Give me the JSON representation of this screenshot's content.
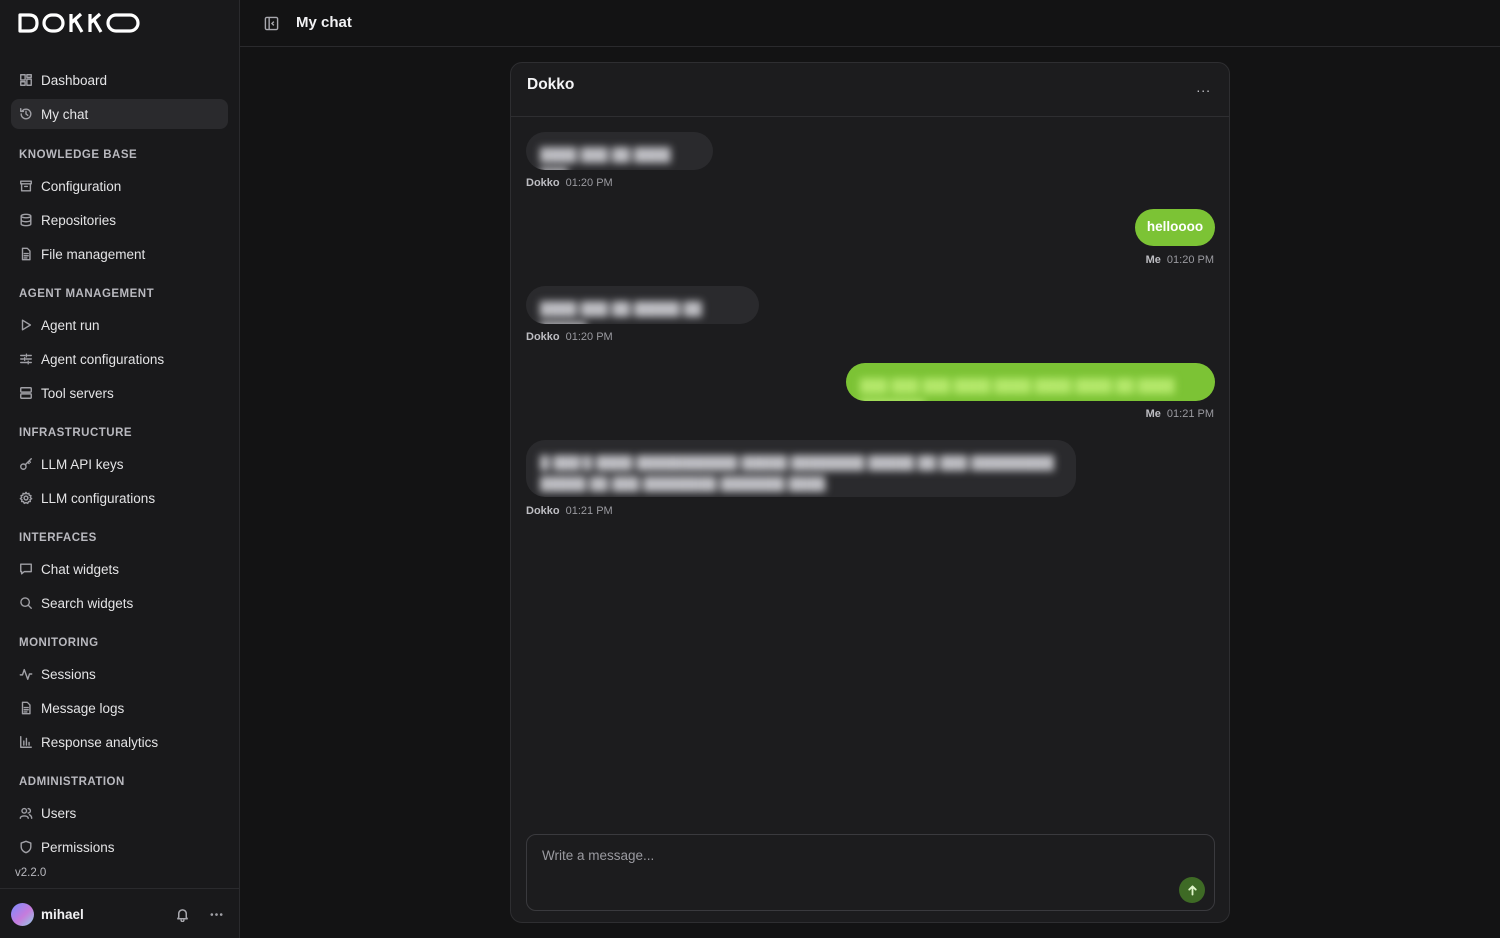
{
  "app": {
    "logo_text": "DOKKO",
    "version": "v2.2.0"
  },
  "header": {
    "title": "My chat"
  },
  "sidebar": {
    "items": [
      {
        "label": "Dashboard",
        "icon": "dashboard-icon"
      },
      {
        "label": "My chat",
        "icon": "history-icon",
        "active": true
      }
    ],
    "sections": [
      {
        "label": "KNOWLEDGE BASE",
        "items": [
          {
            "label": "Configuration",
            "icon": "archive-icon"
          },
          {
            "label": "Repositories",
            "icon": "database-icon"
          },
          {
            "label": "File management",
            "icon": "file-icon"
          }
        ]
      },
      {
        "label": "AGENT MANAGEMENT",
        "items": [
          {
            "label": "Agent run",
            "icon": "play-icon"
          },
          {
            "label": "Agent configurations",
            "icon": "sliders-icon"
          },
          {
            "label": "Tool servers",
            "icon": "server-icon"
          }
        ]
      },
      {
        "label": "INFRASTRUCTURE",
        "items": [
          {
            "label": "LLM API keys",
            "icon": "key-icon"
          },
          {
            "label": "LLM configurations",
            "icon": "gear-icon"
          }
        ]
      },
      {
        "label": "INTERFACES",
        "items": [
          {
            "label": "Chat widgets",
            "icon": "chat-icon"
          },
          {
            "label": "Search widgets",
            "icon": "search-icon"
          }
        ]
      },
      {
        "label": "MONITORING",
        "items": [
          {
            "label": "Sessions",
            "icon": "activity-icon"
          },
          {
            "label": "Message logs",
            "icon": "file-text-icon"
          },
          {
            "label": "Response analytics",
            "icon": "bar-chart-icon"
          }
        ]
      },
      {
        "label": "ADMINISTRATION",
        "items": [
          {
            "label": "Users",
            "icon": "users-icon"
          },
          {
            "label": "Permissions",
            "icon": "shield-icon"
          }
        ]
      }
    ]
  },
  "user": {
    "name": "mihael"
  },
  "chat": {
    "title": "Dokko",
    "menu_label": "...",
    "messages": [
      {
        "sender": "Dokko",
        "time": "01:20 PM",
        "blurred": true
      },
      {
        "sender": "Me",
        "time": "01:20 PM",
        "text": "helloooo"
      },
      {
        "sender": "Dokko",
        "time": "01:20 PM",
        "blurred": true
      },
      {
        "sender": "Me",
        "time": "01:21 PM",
        "blurred": true
      },
      {
        "sender": "Dokko",
        "time": "01:21 PM",
        "blurred": true
      }
    ],
    "input_placeholder": "Write a message..."
  },
  "colors": {
    "accent": "#7cc335",
    "send_button": "#3e6a25",
    "background": "#131314",
    "sidebar": "#19191b"
  }
}
